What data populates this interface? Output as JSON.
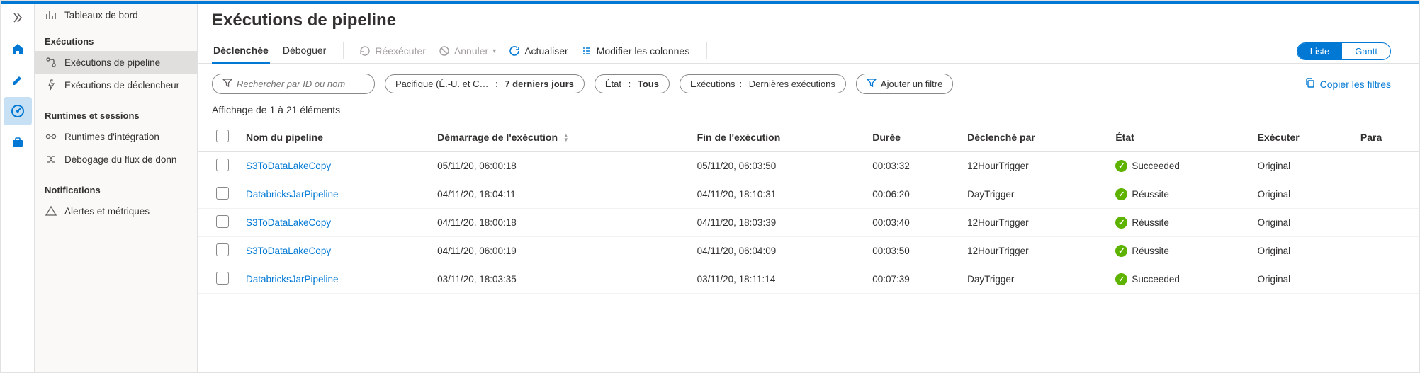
{
  "sidebar": {
    "dashboards": "Tableaux de bord",
    "headers": {
      "executions": "Exécutions",
      "runtimes": "Runtimes et sessions",
      "notifications": "Notifications"
    },
    "pipeline_runs": "Exécutions de pipeline",
    "trigger_runs": "Exécutions de déclencheur",
    "integration_runtimes": "Runtimes d'intégration",
    "dataflow_debug": "Débogage du flux de donn",
    "alerts": "Alertes et métriques"
  },
  "page": {
    "title": "Exécutions de pipeline"
  },
  "tabs": {
    "triggered": "Déclenchée",
    "debug": "Déboguer"
  },
  "toolbar": {
    "rerun": "Réexécuter",
    "cancel": "Annuler",
    "refresh": "Actualiser",
    "edit_columns": "Modifier les colonnes",
    "view_list": "Liste",
    "view_gantt": "Gantt"
  },
  "filters": {
    "search_placeholder": "Rechercher par ID ou nom",
    "timezone_label": "Pacifique (É.-U. et C…",
    "timezone_value": "7 derniers jours",
    "status_label": "État",
    "status_value": "Tous",
    "runs_label": "Exécutions",
    "runs_value": "Dernières exécutions",
    "add_filter": "Ajouter un filtre",
    "copy_filters": "Copier les filtres"
  },
  "table": {
    "count_text": "Affichage de 1 à 21 éléments",
    "columns": {
      "name": "Nom du pipeline",
      "start": "Démarrage de l'exécution",
      "end": "Fin de l'exécution",
      "duration": "Durée",
      "triggered_by": "Déclenché par",
      "status": "État",
      "run": "Exécuter",
      "params": "Para"
    },
    "rows": [
      {
        "name": "S3ToDataLakeCopy",
        "start": "05/11/20, 06:00:18",
        "end": "05/11/20, 06:03:50",
        "duration": "00:03:32",
        "trigger": "12HourTrigger",
        "status": "Succeeded",
        "run": "Original"
      },
      {
        "name": "DatabricksJarPipeline",
        "start": "04/11/20, 18:04:11",
        "end": "04/11/20, 18:10:31",
        "duration": "00:06:20",
        "trigger": "DayTrigger",
        "status": "Réussite",
        "run": "Original"
      },
      {
        "name": "S3ToDataLakeCopy",
        "start": "04/11/20, 18:00:18",
        "end": "04/11/20, 18:03:39",
        "duration": "00:03:40",
        "trigger": "12HourTrigger",
        "status": "Réussite",
        "run": "Original"
      },
      {
        "name": "S3ToDataLakeCopy",
        "start": "04/11/20, 06:00:19",
        "end": "04/11/20, 06:04:09",
        "duration": "00:03:50",
        "trigger": "12HourTrigger",
        "status": "Réussite",
        "run": "Original"
      },
      {
        "name": "DatabricksJarPipeline",
        "start": "03/11/20, 18:03:35",
        "end": "03/11/20, 18:11:14",
        "duration": "00:07:39",
        "trigger": "DayTrigger",
        "status": "Succeeded",
        "run": "Original"
      }
    ]
  }
}
